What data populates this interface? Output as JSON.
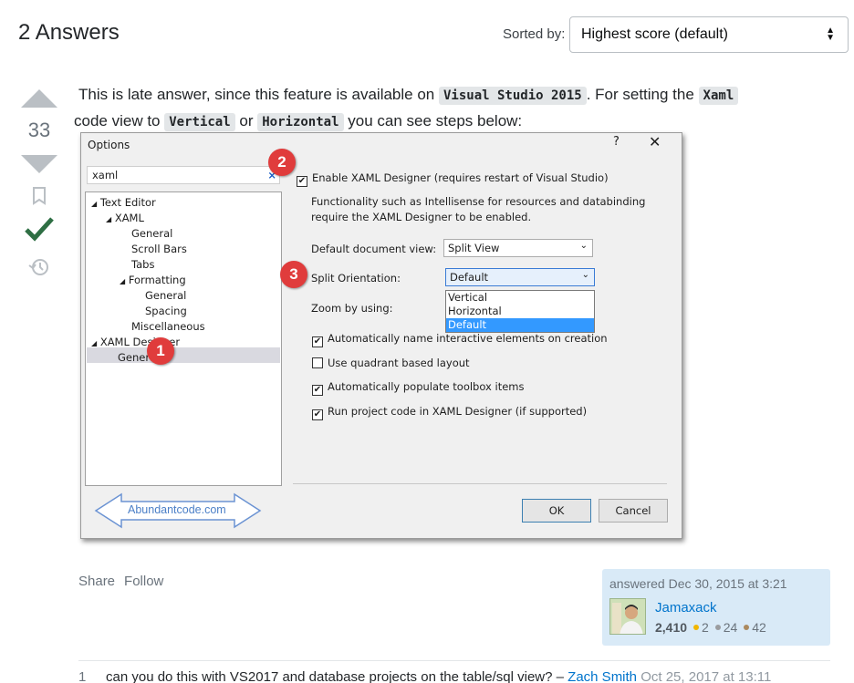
{
  "header": {
    "answers_title": "2 Answers",
    "sort_label": "Sorted by:",
    "sort_value": "Highest score (default)"
  },
  "vote": {
    "count": "33"
  },
  "post": {
    "text_1": "This is late answer, since this feature is available on ",
    "code_1": "Visual Studio 2015",
    "text_2": ". For setting the ",
    "code_2": "Xaml",
    "text_3": " code view to ",
    "code_3": "Vertical",
    "text_4": " or ",
    "code_4": "Horizontal",
    "text_5": " you can see steps below:"
  },
  "dialog": {
    "title": "Options",
    "help": "?",
    "close": "✕",
    "search_value": "xaml",
    "tree": [
      {
        "label": "Text Editor",
        "expander": "◢"
      },
      {
        "label": "XAML",
        "expander": "◢"
      },
      {
        "label": "General",
        "expander": ""
      },
      {
        "label": "Scroll Bars",
        "expander": ""
      },
      {
        "label": "Tabs",
        "expander": ""
      },
      {
        "label": "Formatting",
        "expander": "◢"
      },
      {
        "label": "General",
        "expander": ""
      },
      {
        "label": "Spacing",
        "expander": ""
      },
      {
        "label": "Miscellaneous",
        "expander": ""
      },
      {
        "label": "XAML Designer",
        "expander": "◢"
      },
      {
        "label": "General",
        "expander": ""
      }
    ],
    "enable_designer": "Enable XAML Designer (requires restart of Visual Studio)",
    "description_1": "Functionality such as Intellisense for resources and databinding",
    "description_2": "require the XAML Designer to be enabled.",
    "default_view_label": "Default document view:",
    "default_view_value": "Split View",
    "split_orientation_label": "Split Orientation:",
    "split_orientation_value": "Default",
    "split_options": [
      "Vertical",
      "Horizontal",
      "Default"
    ],
    "zoom_label": "Zoom by using:",
    "auto_name": "Automatically name interactive elements on creation",
    "quadrant": "Use quadrant based layout",
    "toolbox": "Automatically populate toolbox items",
    "run_code": "Run project code in XAML Designer (if supported)",
    "ok": "OK",
    "cancel": "Cancel",
    "badges": [
      "1",
      "2",
      "3"
    ],
    "brand": "Abundantcode.com"
  },
  "post_menu": {
    "share": "Share",
    "follow": "Follow"
  },
  "user_card": {
    "action": "answered Dec 30, 2015 at 3:21",
    "name": "Jamaxack",
    "reputation": "2,410",
    "gold": "2",
    "silver": "24",
    "bronze": "42",
    "colors": {
      "gold": "#f1b600",
      "silver": "#9a9c9f",
      "bronze": "#ab8a5f"
    }
  },
  "comment": {
    "score": "1",
    "text": "can you do this with VS2017 and database projects on the table/sql view? – ",
    "user": "Zach Smith",
    "date": " Oct 25, 2017 at 13:11"
  }
}
